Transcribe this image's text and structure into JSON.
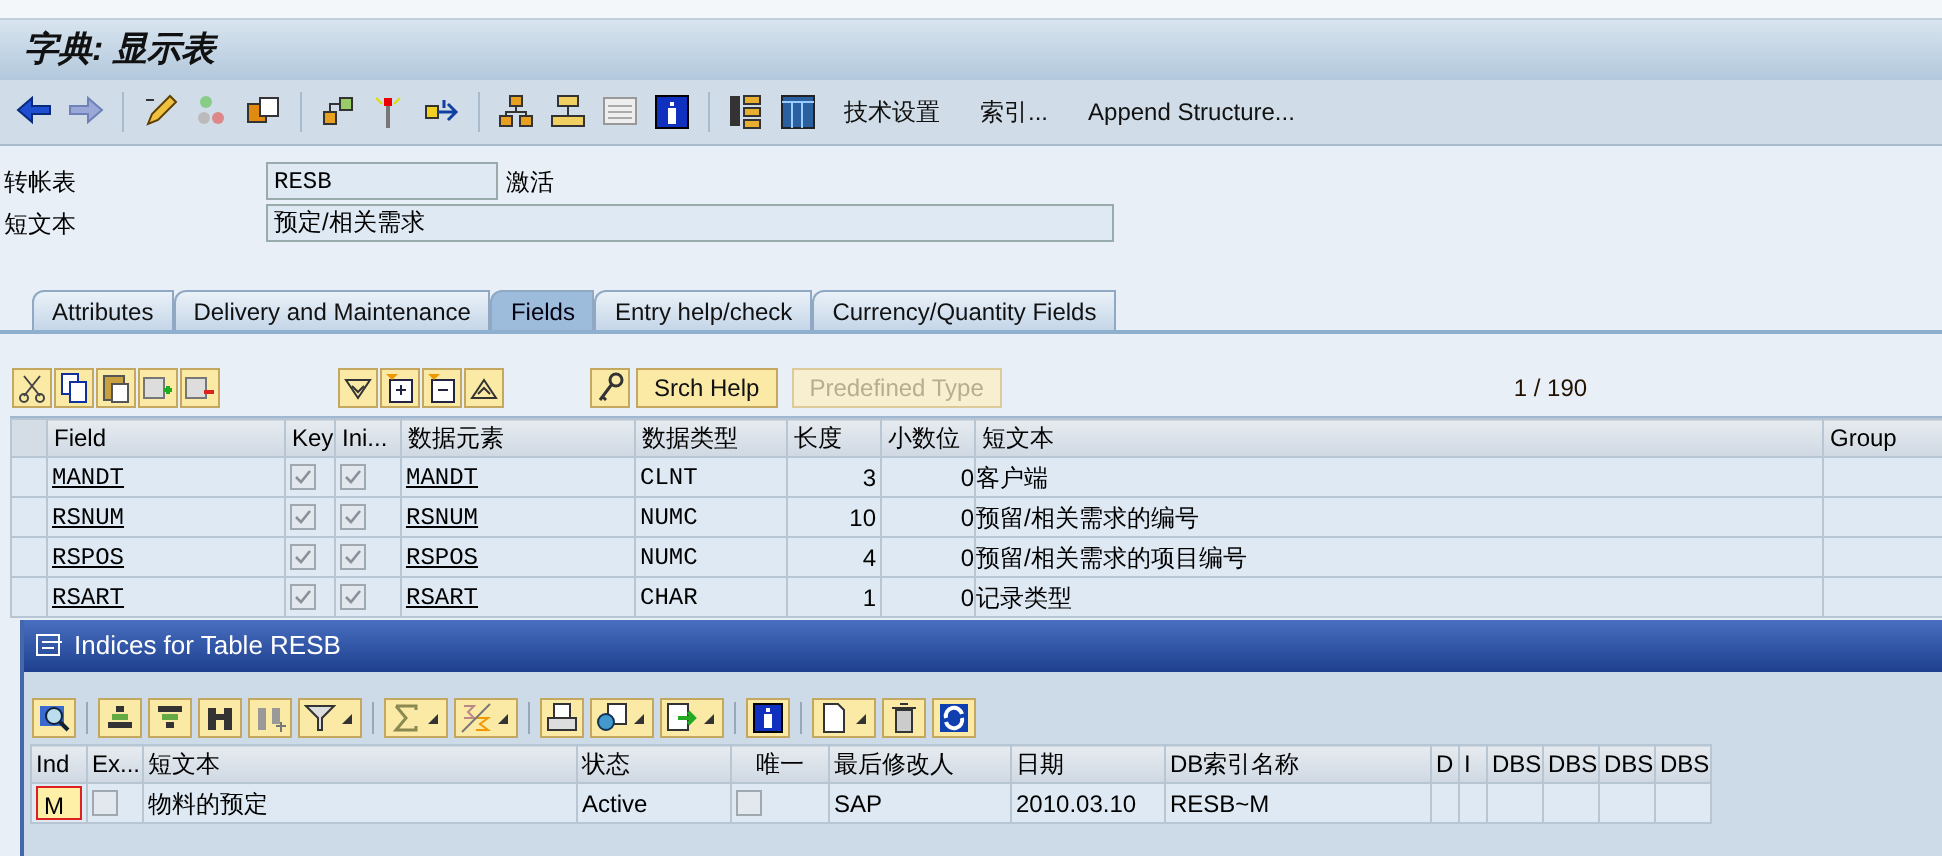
{
  "window": {
    "title": "字典: 显示表"
  },
  "toolbar": {
    "text_buttons": [
      "技术设置",
      "索引...",
      "Append Structure..."
    ]
  },
  "header_fields": [
    {
      "label": "转帐表",
      "value": "RESB",
      "status": "激活"
    },
    {
      "label": "短文本",
      "value": "预定/相关需求"
    }
  ],
  "tabs": [
    {
      "label": "Attributes",
      "selected": false
    },
    {
      "label": "Delivery and Maintenance",
      "selected": false
    },
    {
      "label": "Fields",
      "selected": true
    },
    {
      "label": "Entry help/check",
      "selected": false
    },
    {
      "label": "Currency/Quantity Fields",
      "selected": false
    }
  ],
  "fields_toolbar": {
    "buttons": [
      {
        "label": "Srch Help",
        "disabled": false
      },
      {
        "label": "Predefined Type",
        "disabled": true
      }
    ],
    "page": "1 / 190"
  },
  "fields_table": {
    "columns": [
      "Field",
      "Key",
      "Ini...",
      "数据元素",
      "数据类型",
      "长度",
      "小数位",
      "短文本",
      "Group"
    ],
    "rows": [
      {
        "field": "MANDT",
        "key": true,
        "initial": true,
        "data_element": "MANDT",
        "data_type": "CLNT",
        "length": "3",
        "decimals": "0",
        "short_text": "客户端"
      },
      {
        "field": "RSNUM",
        "key": true,
        "initial": true,
        "data_element": "RSNUM",
        "data_type": "NUMC",
        "length": "10",
        "decimals": "0",
        "short_text": "预留/相关需求的编号"
      },
      {
        "field": "RSPOS",
        "key": true,
        "initial": true,
        "data_element": "RSPOS",
        "data_type": "NUMC",
        "length": "4",
        "decimals": "0",
        "short_text": "预留/相关需求的项目编号"
      },
      {
        "field": "RSART",
        "key": true,
        "initial": true,
        "data_element": "RSART",
        "data_type": "CHAR",
        "length": "1",
        "decimals": "0",
        "short_text": "记录类型"
      }
    ]
  },
  "dialog": {
    "title": "Indices for Table RESB",
    "table": {
      "columns": [
        "Ind",
        "Ex...",
        "短文本",
        "状态",
        "唯一",
        "最后修改人",
        "日期",
        "DB索引名称",
        "D",
        "I",
        "DBS",
        "DBS",
        "DBS",
        "DBS"
      ],
      "rows": [
        {
          "index": "M",
          "selected": true,
          "extension": false,
          "short_text": "物料的预定",
          "status": "Active",
          "unique": false,
          "changed_by": "SAP",
          "date": "2010.03.10",
          "db_index_name": "RESB~M"
        }
      ]
    }
  }
}
